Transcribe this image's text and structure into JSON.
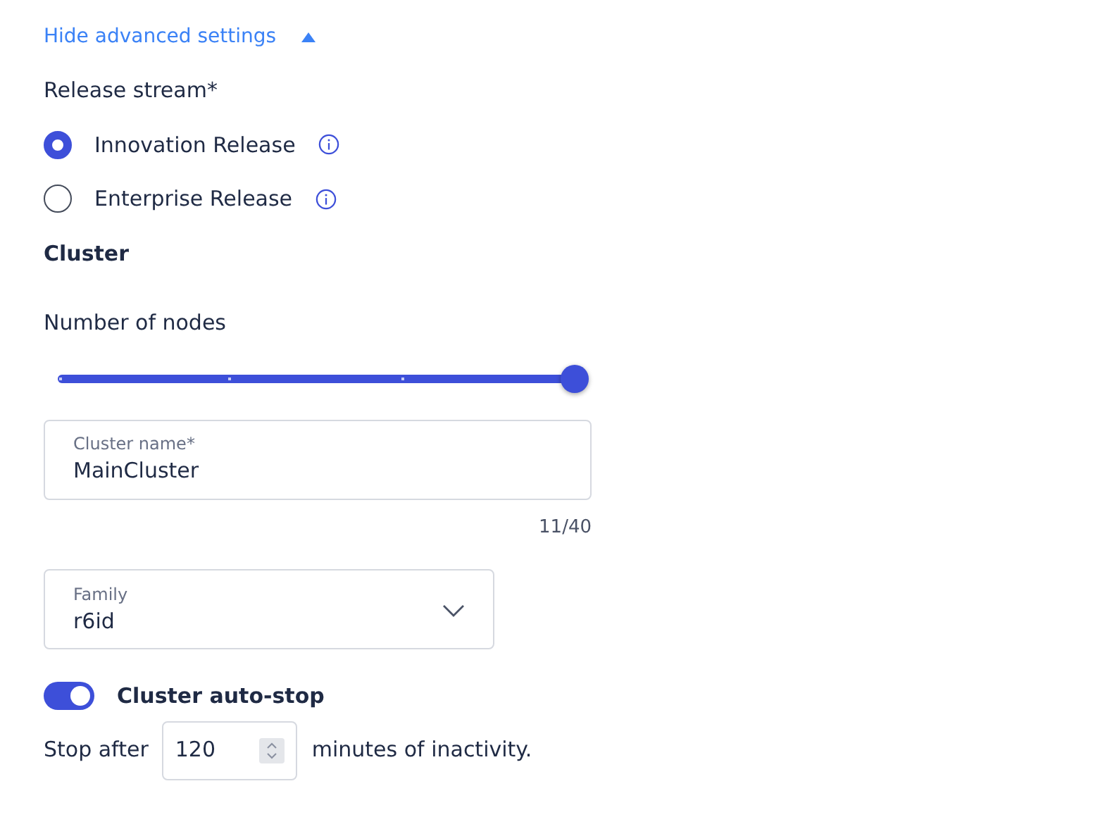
{
  "advanced_toggle": {
    "label": "Hide advanced settings",
    "expanded": true
  },
  "release_stream": {
    "label": "Release stream*",
    "options": [
      {
        "label": "Innovation Release",
        "selected": true
      },
      {
        "label": "Enterprise Release",
        "selected": false
      }
    ]
  },
  "cluster": {
    "heading": "Cluster",
    "nodes": {
      "label": "Number of nodes",
      "level": 1.0
    },
    "name_field": {
      "label": "Cluster name*",
      "value": "MainCluster",
      "counter": "11/40"
    },
    "family_select": {
      "label": "Family",
      "value": "r6id"
    },
    "auto_stop": {
      "label": "Cluster auto-stop",
      "on": true
    },
    "stop_after": {
      "prefix": "Stop after",
      "value": "120",
      "suffix": "minutes of inactivity."
    }
  }
}
